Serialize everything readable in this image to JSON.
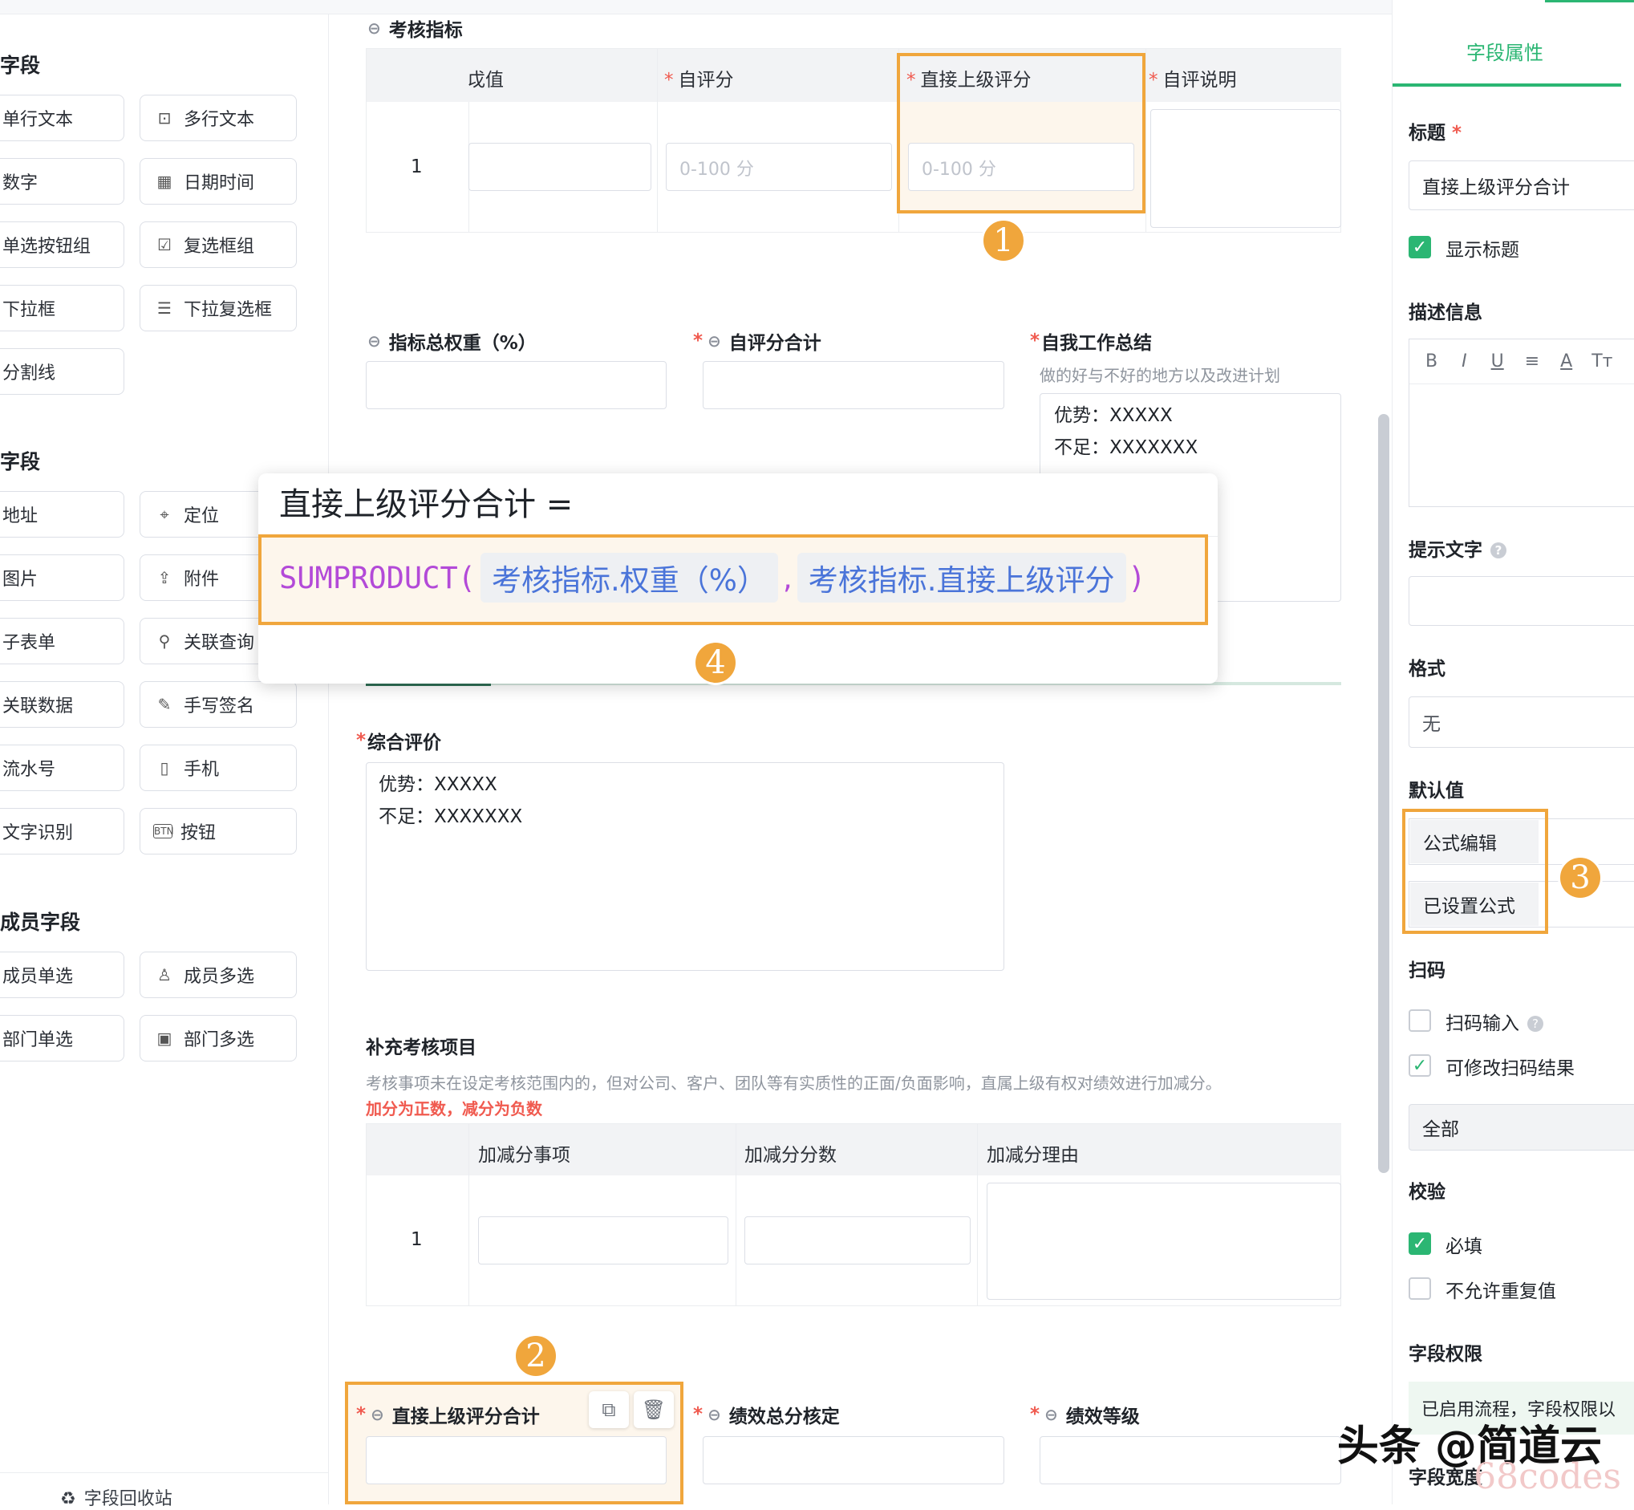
{
  "left": {
    "sections": [
      {
        "title": "字段",
        "items": [
          [
            "单行文本",
            "多行文本"
          ],
          [
            "数字",
            "日期时间"
          ],
          [
            "单选按钮组",
            "复选框组"
          ],
          [
            "下拉框",
            "下拉复选框"
          ],
          [
            "分割线",
            ""
          ]
        ]
      },
      {
        "title": "字段",
        "items": [
          [
            "地址",
            "定位"
          ],
          [
            "图片",
            "附件"
          ],
          [
            "子表单",
            "关联查询"
          ],
          [
            "关联数据",
            "手写签名"
          ],
          [
            "流水号",
            "手机"
          ],
          [
            "文字识别",
            "按钮"
          ]
        ]
      },
      {
        "title": "成员字段",
        "items": [
          [
            "成员单选",
            "成员多选"
          ],
          [
            "部门单选",
            "部门多选"
          ]
        ]
      }
    ],
    "icons": {
      "多行文本": "multiline-text-icon",
      "日期时间": "calendar-icon",
      "复选框组": "checkbox-group-icon",
      "下拉复选框": "dropdown-checkbox-icon",
      "定位": "location-icon",
      "附件": "attachment-icon",
      "关联查询": "related-query-icon",
      "手写签名": "signature-icon",
      "手机": "phone-icon",
      "按钮": "button-icon",
      "成员多选": "members-icon",
      "部门多选": "departments-icon"
    },
    "recycle": "字段回收站"
  },
  "canvas": {
    "kpi": {
      "title": "考核指标",
      "headers": [
        "戉值",
        "自评分",
        "直接上级评分",
        "自评说明"
      ],
      "row_index": "1",
      "score_placeholder": "0-100 分"
    },
    "weight_total": "指标总权重（%）",
    "self_total": "自评分合计",
    "summary": {
      "title": "自我工作总结",
      "desc": "做的好与不好的地方以及改进计划",
      "value_line1": "优势：XXXXX",
      "value_line2": "不足：XXXXXXX"
    },
    "formula": {
      "title": "直接上级评分合计 =",
      "fn": "SUMPRODUCT(",
      "arg1": "考核指标.权重（%）",
      "sep": ",",
      "arg2": "考核指标.直接上级评分",
      "close": ")"
    },
    "overall": {
      "title": "综合评价",
      "value_line1": "优势：XXXXX",
      "value_line2": "不足：XXXXXXX"
    },
    "extra": {
      "title": "补充考核项目",
      "desc": "考核事项未在设定考核范围内的，但对公司、客户、团队等有实质性的正面/负面影响，直属上级有权对绩效进行加减分。",
      "desc_red": "加分为正数，减分为负数",
      "headers": [
        "加减分事项",
        "加减分分数",
        "加减分理由"
      ],
      "row_index": "1"
    },
    "bottom_fields": [
      "直接上级评分合计",
      "绩效总分核定",
      "绩效等级"
    ],
    "badges": [
      "1",
      "2",
      "3",
      "4"
    ]
  },
  "right": {
    "tab": "字段属性",
    "title_label": "标题",
    "title_value": "直接上级评分合计",
    "show_title": "显示标题",
    "desc_label": "描述信息",
    "toolbar": [
      "B",
      "I",
      "U",
      "≡",
      "A",
      "Tт"
    ],
    "hint_label": "提示文字",
    "format_label": "格式",
    "format_value": "无",
    "default_label": "默认值",
    "default_mode": "公式编辑",
    "default_status": "已设置公式",
    "scan_label": "扫码",
    "scan_input": "扫码输入",
    "scan_editable": "可修改扫码结果",
    "scan_range": "全部",
    "validate_label": "校验",
    "required": "必填",
    "no_dup": "不允许重复值",
    "perm_label": "字段权限",
    "perm_text": "已启用流程，字段权限以",
    "width_label": "字段宽度"
  },
  "watermark": "头条 @简道云",
  "watermark2": "68codes"
}
